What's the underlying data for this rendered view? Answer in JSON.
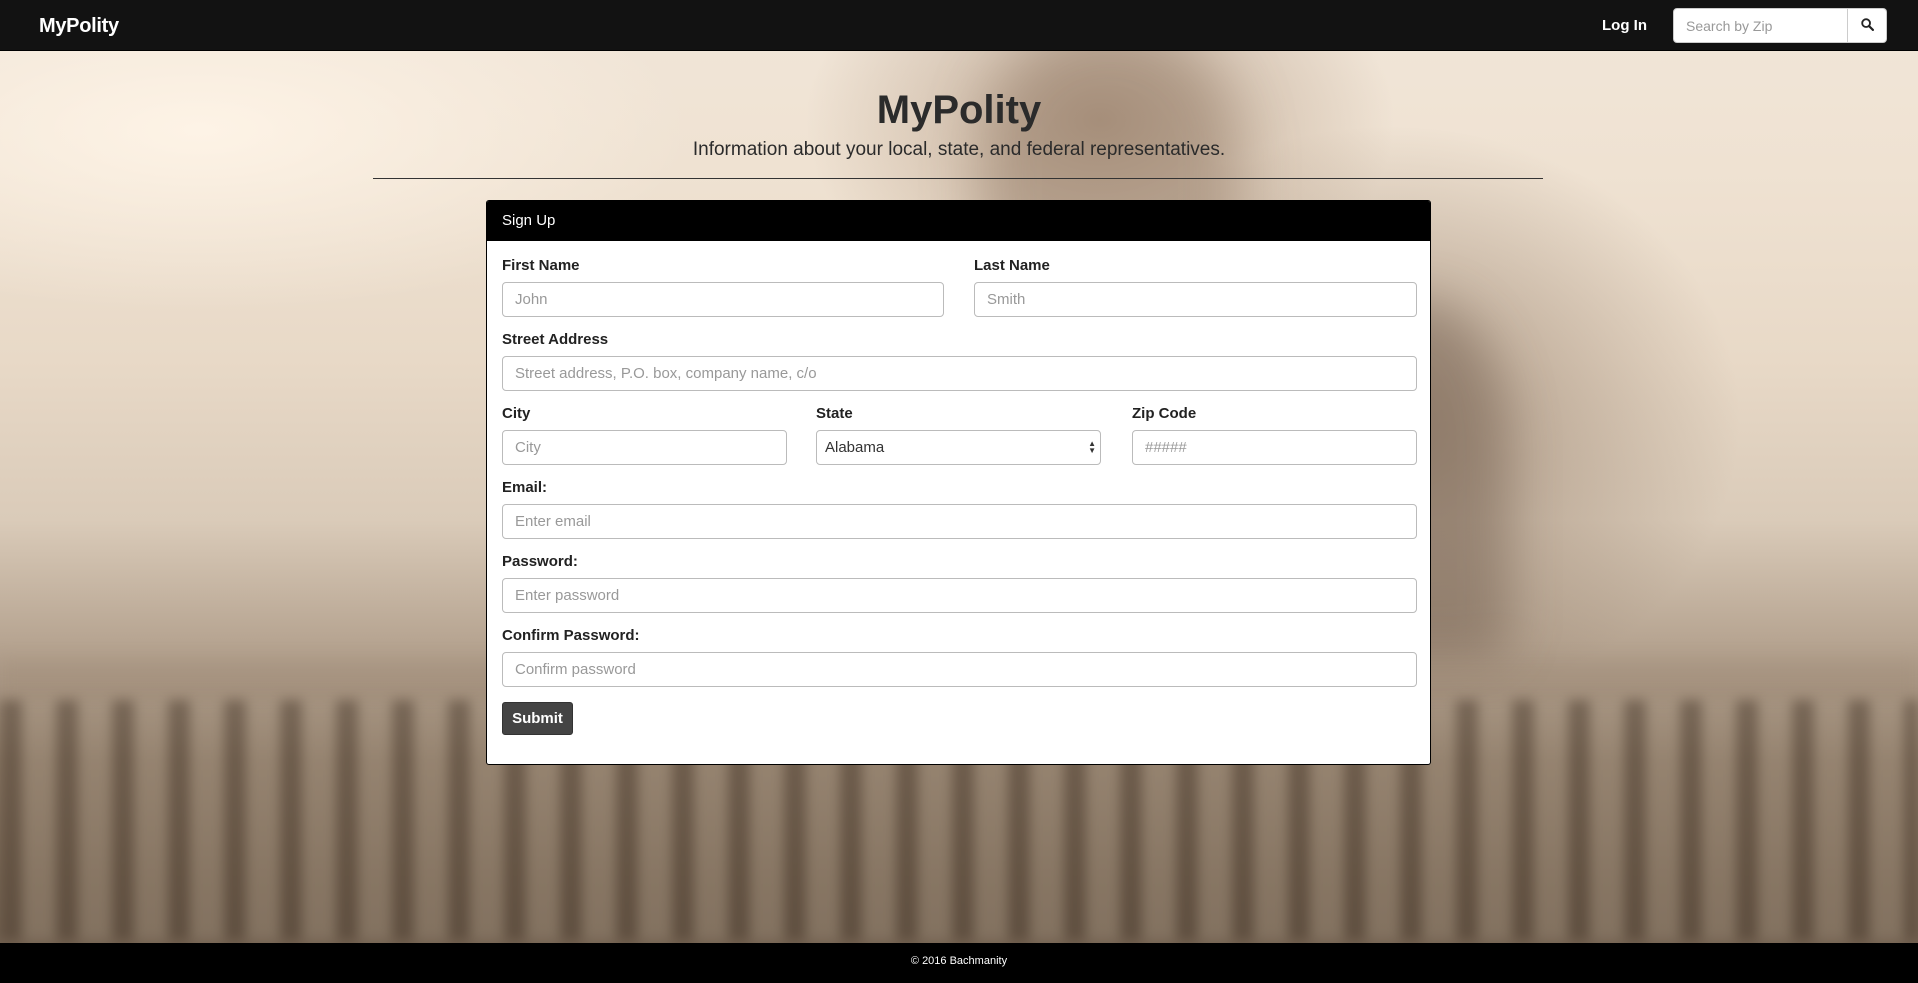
{
  "navbar": {
    "brand": "MyPolity",
    "login_label": "Log In",
    "search_placeholder": "Search by Zip",
    "search_icon": "search-icon"
  },
  "header": {
    "title": "MyPolity",
    "subtitle": "Information about your local, state, and federal representatives."
  },
  "signup": {
    "heading": "Sign Up",
    "first_name": {
      "label": "First Name",
      "placeholder": "John",
      "value": ""
    },
    "last_name": {
      "label": "Last Name",
      "placeholder": "Smith",
      "value": ""
    },
    "street": {
      "label": "Street Address",
      "placeholder": "Street address, P.O. box, company name, c/o",
      "value": ""
    },
    "city": {
      "label": "City",
      "placeholder": "City",
      "value": ""
    },
    "state": {
      "label": "State",
      "selected": "Alabama"
    },
    "zip": {
      "label": "Zip Code",
      "placeholder": "#####",
      "value": ""
    },
    "email": {
      "label": "Email:",
      "placeholder": "Enter email",
      "value": ""
    },
    "password": {
      "label": "Password:",
      "placeholder": "Enter password",
      "value": ""
    },
    "confirm_password": {
      "label": "Confirm Password:",
      "placeholder": "Confirm password",
      "value": ""
    },
    "submit_label": "Submit"
  },
  "footer": {
    "copyright": "© 2016 Bachmanity"
  },
  "colors": {
    "navbar_bg": "#121212",
    "panel_heading_bg": "#000000",
    "submit_bg": "#444444"
  }
}
